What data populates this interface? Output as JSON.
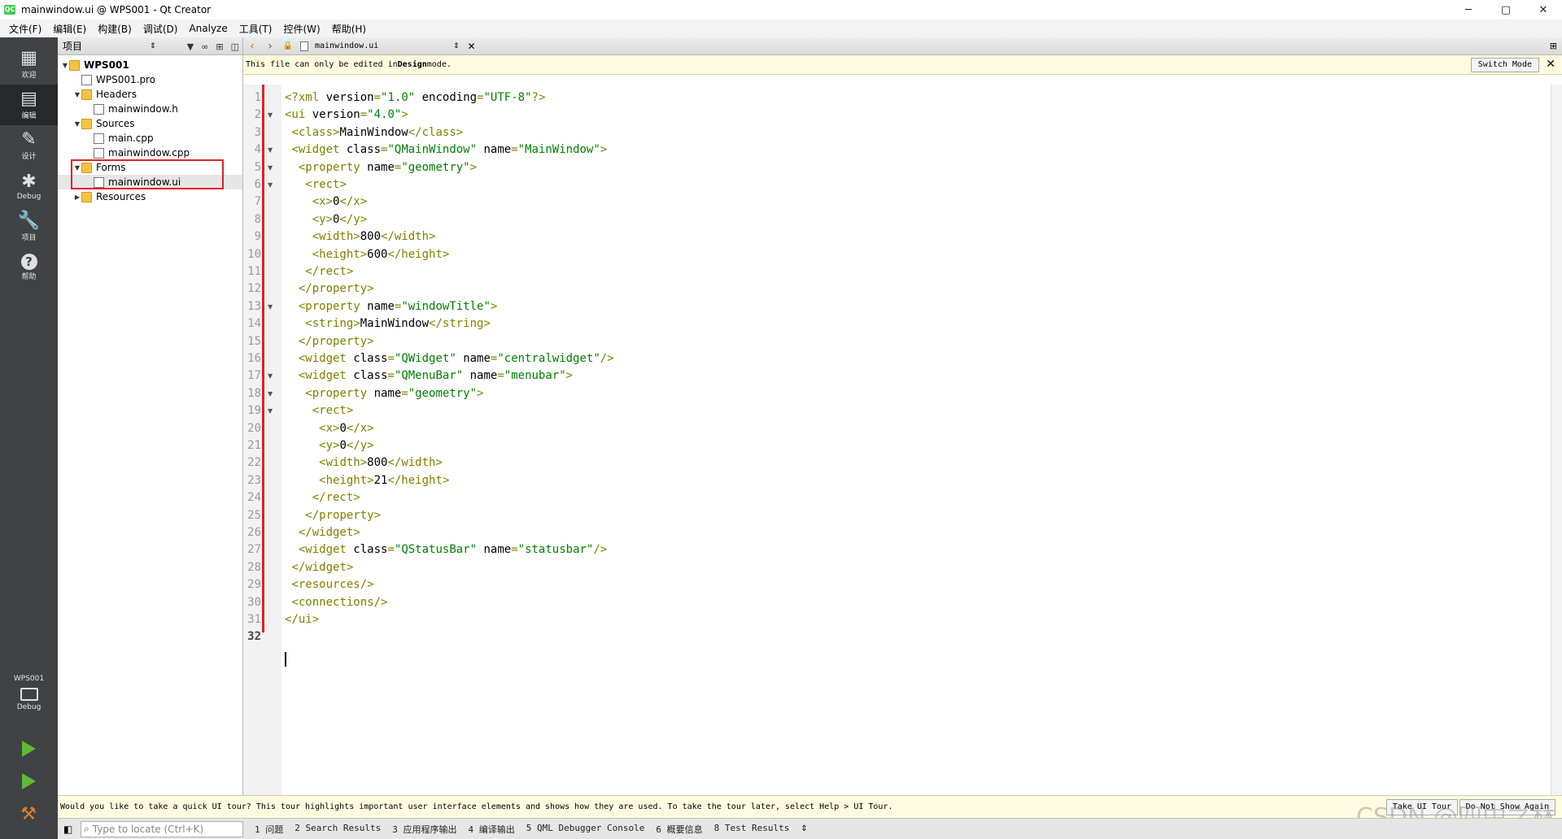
{
  "window": {
    "title": "mainwindow.ui @ WPS001 - Qt Creator",
    "app_icon": "QC"
  },
  "menubar": [
    "文件(F)",
    "编辑(E)",
    "构建(B)",
    "调试(D)",
    "Analyze",
    "工具(T)",
    "控件(W)",
    "帮助(H)"
  ],
  "modes": [
    {
      "label": "欢迎",
      "icon": "grid-icon"
    },
    {
      "label": "编辑",
      "icon": "edit-icon"
    },
    {
      "label": "设计",
      "icon": "pen-icon"
    },
    {
      "label": "Debug",
      "icon": "bug-icon"
    },
    {
      "label": "项目",
      "icon": "wrench-icon"
    },
    {
      "label": "帮助",
      "icon": "help-icon"
    }
  ],
  "kit": {
    "project": "WPS001",
    "mode": "Debug"
  },
  "project_panel": {
    "combo": "项目",
    "tree": [
      {
        "label": "WPS001",
        "bold": true
      },
      {
        "label": "WPS001.pro"
      },
      {
        "label": "Headers"
      },
      {
        "label": "mainwindow.h"
      },
      {
        "label": "Sources"
      },
      {
        "label": "main.cpp"
      },
      {
        "label": "mainwindow.cpp"
      },
      {
        "label": "Forms"
      },
      {
        "label": "mainwindow.ui"
      },
      {
        "label": "Resources"
      }
    ]
  },
  "editor": {
    "file": "mainwindow.ui",
    "info_message_prefix": "This file can only be edited in ",
    "info_message_bold": "Design",
    "info_message_suffix": " mode.",
    "switch_button": "Switch Mode",
    "lines": [
      "<?xml version=\"1.0\" encoding=\"UTF-8\"?>",
      "<ui version=\"4.0\">",
      " <class>MainWindow</class>",
      " <widget class=\"QMainWindow\" name=\"MainWindow\">",
      "  <property name=\"geometry\">",
      "   <rect>",
      "    <x>0</x>",
      "    <y>0</y>",
      "    <width>800</width>",
      "    <height>600</height>",
      "   </rect>",
      "  </property>",
      "  <property name=\"windowTitle\">",
      "   <string>MainWindow</string>",
      "  </property>",
      "  <widget class=\"QWidget\" name=\"centralwidget\"/>",
      "  <widget class=\"QMenuBar\" name=\"menubar\">",
      "   <property name=\"geometry\">",
      "    <rect>",
      "     <x>0</x>",
      "     <y>0</y>",
      "     <width>800</width>",
      "     <height>21</height>",
      "    </rect>",
      "   </property>",
      "  </widget>",
      "  <widget class=\"QStatusBar\" name=\"statusbar\"/>",
      " </widget>",
      " <resources/>",
      " <connections/>",
      "</ui>",
      ""
    ],
    "folds": [
      2,
      4,
      5,
      6,
      13,
      17,
      18,
      19
    ]
  },
  "tour": {
    "message": "Would you like to take a quick UI tour? This tour highlights important user interface elements and shows how they are used. To take the tour later, select Help > UI Tour.",
    "take_button": "Take UI Tour",
    "dont_show_button": "Do Not Show Again"
  },
  "statusbar": {
    "locate_placeholder": "Type to locate (Ctrl+K)",
    "panes": [
      "1 问题",
      "2 Search Results",
      "3 应用程序输出",
      "4 编译输出",
      "5 QML Debugger Console",
      "6 概要信息",
      "8 Test Results"
    ]
  },
  "watermark": "CSDN @四中之林",
  "colors": {
    "tag": "#808000",
    "attr_value": "#008000",
    "change_bar": "#e0212b",
    "sidebar": "#404244"
  }
}
